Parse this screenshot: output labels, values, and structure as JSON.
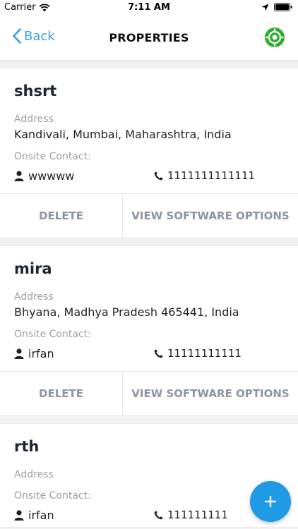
{
  "status_bar": {
    "carrier": "Carrier",
    "time": "7:11 AM"
  },
  "nav": {
    "back_label": "Back",
    "title": "PROPERTIES"
  },
  "labels": {
    "address": "Address",
    "onsite_contact": "Onsite Contact:"
  },
  "actions": {
    "delete": "DELETE",
    "view_options": "VIEW SOFTWARE OPTIONS"
  },
  "properties": [
    {
      "name": "shsrt",
      "address": "Kandivali, Mumbai, Maharashtra, India",
      "contact_name": "wwwww",
      "contact_phone": "1111111111111"
    },
    {
      "name": "mira",
      "address": "Bhyana, Madhya Pradesh 465441, India",
      "contact_name": "irfan",
      "contact_phone": "11111111111"
    },
    {
      "name": "rth",
      "address": "",
      "contact_name": "irfan",
      "contact_phone": "111111111"
    }
  ],
  "colors": {
    "accent": "#1e9be4",
    "back": "#3a9fe0",
    "locate": "#2fae2f"
  }
}
